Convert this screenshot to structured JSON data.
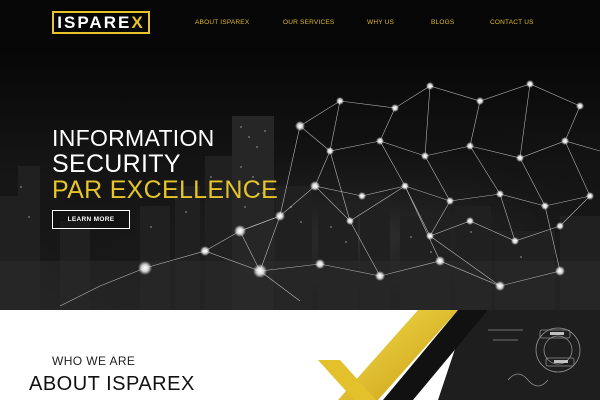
{
  "brand": {
    "logo_text_main": "ISPARE",
    "logo_text_accent": "X"
  },
  "nav": {
    "items": [
      {
        "label": "ABOUT ISPAREX"
      },
      {
        "label": "OUR SERVICES"
      },
      {
        "label": "WHY US"
      },
      {
        "label": "BLOGS"
      },
      {
        "label": "CONTACT US"
      }
    ]
  },
  "hero": {
    "line1": "INFORMATION",
    "line2": "SECURITY",
    "line3": "PAR EXCELLENCE",
    "cta_label": "LEARN MORE"
  },
  "about": {
    "eyebrow": "WHO WE ARE",
    "title": "ABOUT ISPAREX"
  },
  "colors": {
    "accent": "#e6c42a",
    "nav_bg": "#060606",
    "hero_bg": "#0d0d0d"
  }
}
